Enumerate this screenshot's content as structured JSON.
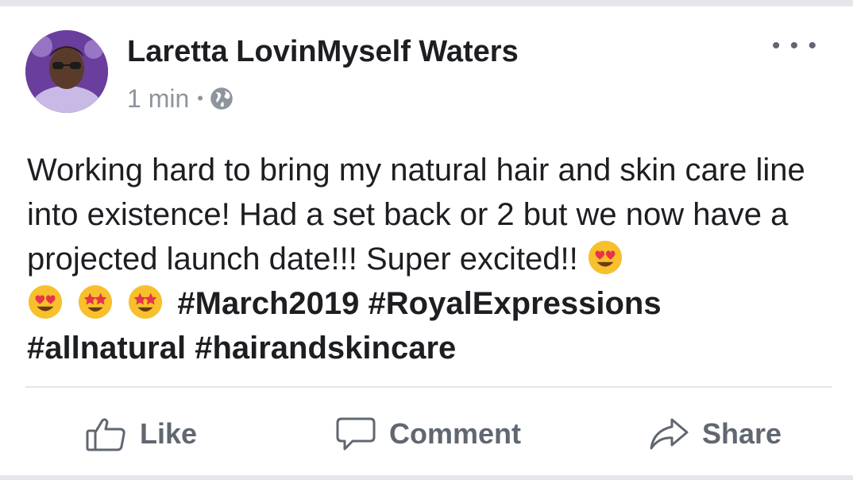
{
  "post": {
    "author": "Laretta LovinMyself Waters",
    "time": "1 min",
    "separator": "•",
    "privacy_icon": "globe-icon",
    "more_icon": "more-options-icon",
    "text_line1": "Working hard to bring my natural hair and skin care line into existence! Had a set back or 2 but we now have a projected launch date!!! Super excited!!",
    "emojis": [
      "heart-eyes-emoji",
      "heart-eyes-emoji",
      "star-struck-emoji",
      "star-struck-emoji"
    ],
    "hashtags": [
      "#March2019",
      "#RoyalExpressions",
      "#allnatural",
      "#hairandskincare"
    ]
  },
  "actions": {
    "like": "Like",
    "comment": "Comment",
    "share": "Share"
  },
  "colors": {
    "text": "#1c1e21",
    "secondary": "#606770",
    "meta": "#8d949e",
    "divider": "#e4e6eb"
  }
}
